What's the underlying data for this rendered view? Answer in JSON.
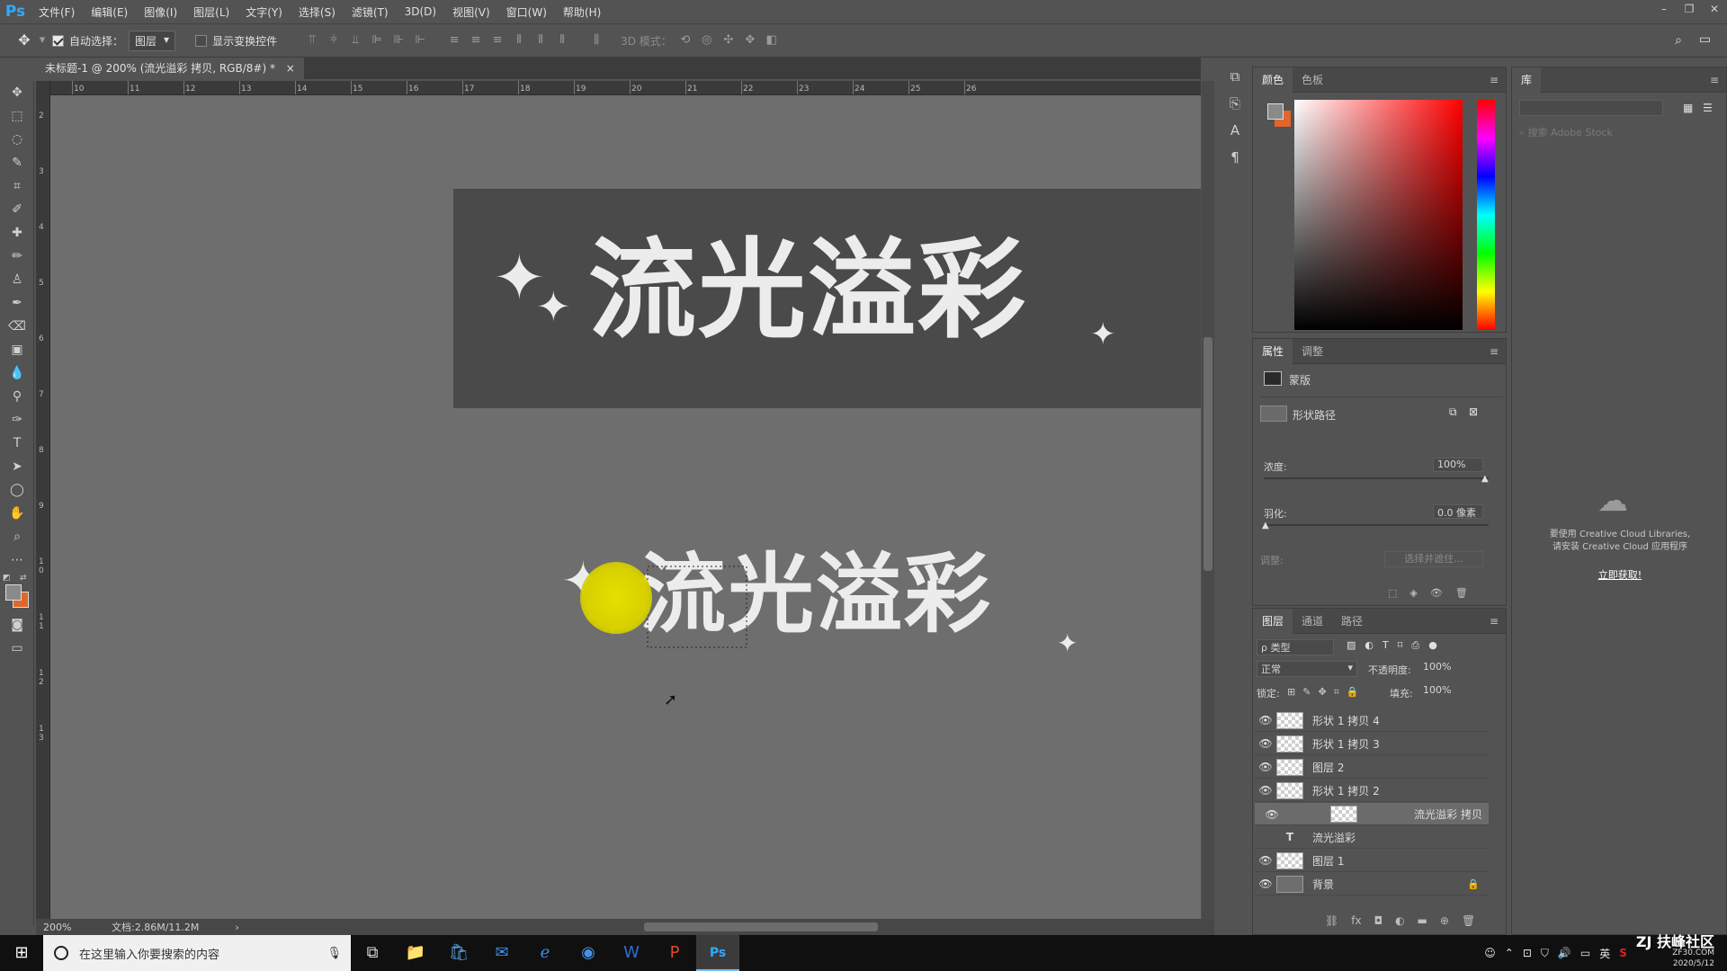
{
  "app": {
    "logo": "Ps"
  },
  "menu": [
    "文件(F)",
    "编辑(E)",
    "图像(I)",
    "图层(L)",
    "文字(Y)",
    "选择(S)",
    "滤镜(T)",
    "3D(D)",
    "视图(V)",
    "窗口(W)",
    "帮助(H)"
  ],
  "window_controls": {
    "minimize": "–",
    "restore": "❐",
    "close": "✕"
  },
  "options_bar": {
    "auto_select_label": "自动选择：",
    "auto_select_checked": true,
    "auto_select_target": "图层",
    "show_transform_label": "显示变换控件",
    "show_transform_checked": false,
    "mode_3d_label": "3D 模式："
  },
  "document": {
    "tab_title": "未标题-1 @ 200% (流光溢彩 拷贝, RGB/8#) *",
    "close_glyph": "×",
    "zoom": "200%",
    "doc_info": "文档:2.86M/11.2M"
  },
  "ruler": {
    "h_ticks": [
      "10",
      "11",
      "12",
      "13",
      "14",
      "15",
      "16",
      "17",
      "18",
      "19",
      "20",
      "21",
      "22",
      "23",
      "24",
      "25",
      "26"
    ],
    "v_ticks": [
      "2",
      "3",
      "4",
      "5",
      "6",
      "7",
      "8",
      "9",
      "1 0",
      "1 1",
      "1 2",
      "1 3"
    ]
  },
  "canvas": {
    "top_text": "流光溢彩",
    "bottom_text": "流光溢彩",
    "star_glyph": "✦"
  },
  "color_panel": {
    "tabs": [
      "颜色",
      "色板"
    ],
    "foreground": "#8a8a8a",
    "background": "#e2652b",
    "hue_color": "#ff0000"
  },
  "library_panel": {
    "tab": "库",
    "search_placeholder": "搜索 Adobe Stock",
    "message_line1": "要使用 Creative Cloud Libraries,",
    "message_line2": "请安装 Creative Cloud 应用程序",
    "link": "立即获取!"
  },
  "properties_panel": {
    "tabs": [
      "属性",
      "调整"
    ],
    "mask_label": "蒙版",
    "shape_path_label": "形状路径",
    "density_label": "浓度:",
    "density_value": "100%",
    "feather_label": "羽化:",
    "feather_value": "0.0 像素",
    "adjust_label": "调整:",
    "select_mask_btn": "选择并遮住..."
  },
  "layers_panel": {
    "tabs": [
      "图层",
      "通道",
      "路径"
    ],
    "filter_label": "ρ 类型",
    "blend_mode": "正常",
    "opacity_label": "不透明度:",
    "opacity_value": "100%",
    "lock_label": "锁定:",
    "fill_label": "填充:",
    "fill_value": "100%",
    "layers": [
      {
        "name": "形状 1 拷贝 4",
        "visible": true,
        "type": "shape"
      },
      {
        "name": "形状 1 拷贝 3",
        "visible": true,
        "type": "shape"
      },
      {
        "name": "图层 2",
        "visible": true,
        "type": "pixel"
      },
      {
        "name": "形状 1 拷贝 2",
        "visible": true,
        "type": "shape"
      },
      {
        "name": "流光溢彩 拷贝",
        "visible": true,
        "type": "shape",
        "selected": true
      },
      {
        "name": "流光溢彩",
        "visible": false,
        "type": "text"
      },
      {
        "name": "图层 1",
        "visible": true,
        "type": "pixel"
      },
      {
        "name": "背景",
        "visible": true,
        "type": "background",
        "locked": true
      }
    ]
  },
  "taskbar": {
    "search_placeholder": "在这里输入你要搜索的内容",
    "ime": "英",
    "watermark": "ZJ 扶峰社区",
    "watermark_sub": "ZF30.COM",
    "date": "2020/5/12"
  }
}
